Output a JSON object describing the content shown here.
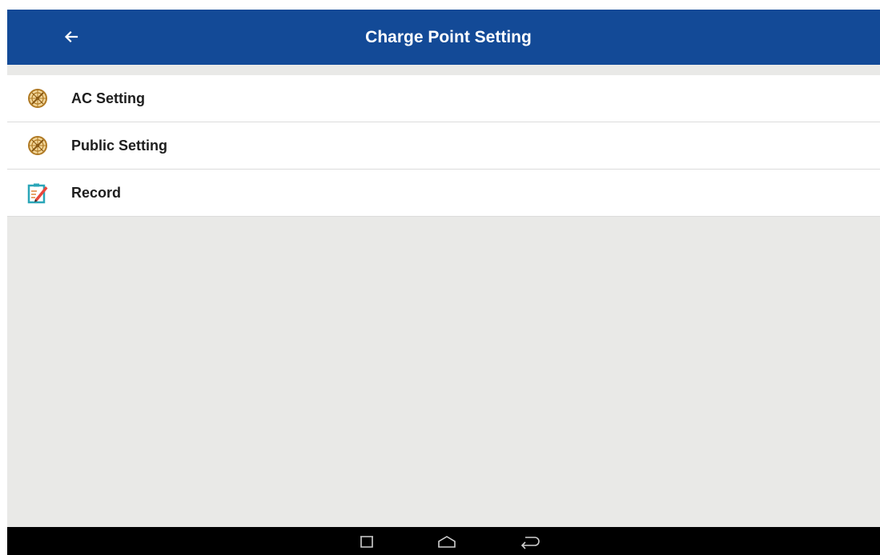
{
  "appbar": {
    "title": "Charge Point Setting",
    "back_icon": "arrow-left-icon",
    "color": "#134a97"
  },
  "list": {
    "items": [
      {
        "label": "AC Setting",
        "icon": "compass-icon"
      },
      {
        "label": "Public Setting",
        "icon": "compass-icon"
      },
      {
        "label": "Record",
        "icon": "clipboard-edit-icon"
      }
    ]
  },
  "navbar": {
    "buttons": [
      "recent-apps-icon",
      "home-icon",
      "back-icon"
    ]
  }
}
